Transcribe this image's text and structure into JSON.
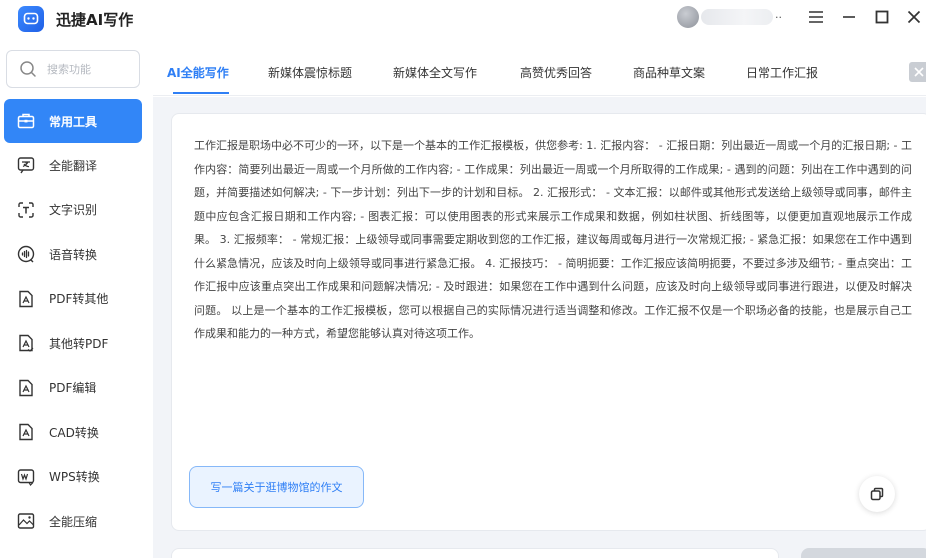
{
  "app": {
    "title": "迅捷AI写作"
  },
  "search": {
    "placeholder": "搜索功能"
  },
  "sidebar": {
    "items": [
      {
        "label": "常用工具",
        "icon": "toolbox-icon",
        "active": true
      },
      {
        "label": "全能翻译",
        "icon": "translate-icon"
      },
      {
        "label": "文字识别",
        "icon": "text-recognition-icon"
      },
      {
        "label": "语音转换",
        "icon": "voice-convert-icon"
      },
      {
        "label": "PDF转其他",
        "icon": "pdf-convert-icon"
      },
      {
        "label": "其他转PDF",
        "icon": "to-pdf-icon"
      },
      {
        "label": "PDF编辑",
        "icon": "pdf-edit-icon"
      },
      {
        "label": "CAD转换",
        "icon": "cad-convert-icon"
      },
      {
        "label": "WPS转换",
        "icon": "wps-convert-icon"
      },
      {
        "label": "全能压缩",
        "icon": "compress-icon"
      }
    ]
  },
  "titlebar": {
    "more": "..",
    "user": ""
  },
  "tabs": [
    {
      "label": "AI全能写作",
      "active": true
    },
    {
      "label": "新媒体震惊标题"
    },
    {
      "label": "新媒体全文写作"
    },
    {
      "label": "高赞优秀回答"
    },
    {
      "label": "商品种草文案"
    },
    {
      "label": "日常工作汇报"
    }
  ],
  "document": {
    "text": "工作汇报是职场中必不可少的一环，以下是一个基本的工作汇报模板，供您参考: 1. 汇报内容： - 汇报日期：列出最近一周或一个月的汇报日期; - 工作内容：简要列出最近一周或一个月所做的工作内容; - 工作成果：列出最近一周或一个月所取得的工作成果; - 遇到的问题：列出在工作中遇到的问题，并简要描述如何解决; - 下一步计划：列出下一步的计划和目标。 2. 汇报形式： - 文本汇报：以邮件或其他形式发送给上级领导或同事，邮件主题中应包含汇报日期和工作内容; - 图表汇报：可以使用图表的形式来展示工作成果和数据，例如柱状图、折线图等，以便更加直观地展示工作成果。 3. 汇报频率： - 常规汇报：上级领导或同事需要定期收到您的工作汇报，建议每周或每月进行一次常规汇报; - 紧急汇报：如果您在工作中遇到什么紧急情况，应该及时向上级领导或同事进行紧急汇报。 4. 汇报技巧： - 简明扼要：工作汇报应该简明扼要，不要过多涉及细节; - 重点突出：工作汇报中应该重点突出工作成果和问题解决情况; - 及时跟进：如果您在工作中遇到什么问题，应该及时向上级领导或同事进行跟进，以便及时解决问题。 以上是一个基本的工作汇报模板，您可以根据自己的实际情况进行适当调整和修改。工作汇报不仅是一个职场必备的技能，也是展示自己工作成果和能力的一种方式，希望您能够认真对待这项工作。"
  },
  "prompt_chip": {
    "label": "写一篇关于逛博物馆的作文"
  },
  "colors": {
    "accent": "#2f7ff5",
    "active_nav": "#3286f7",
    "background": "#f2f4f8"
  }
}
